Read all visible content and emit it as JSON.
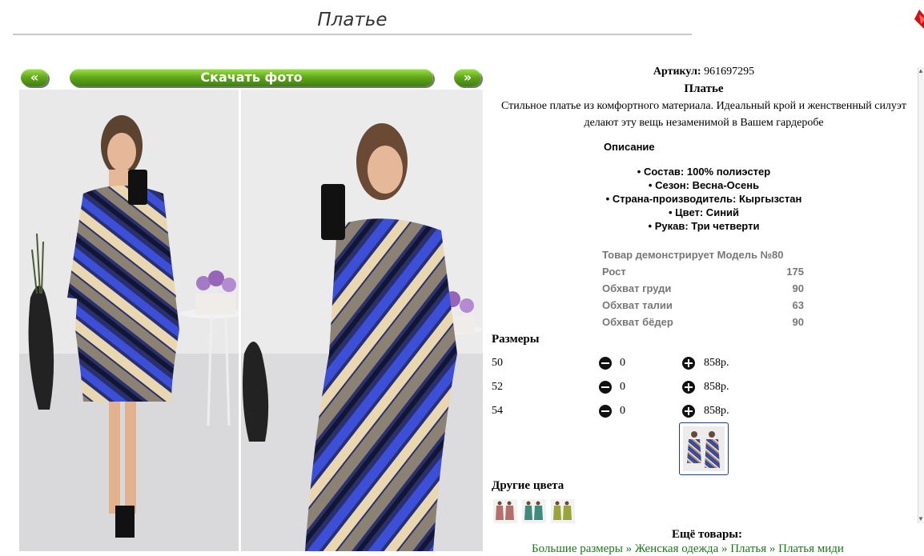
{
  "header": {
    "title": "Платье"
  },
  "gallery": {
    "prev_label": "«",
    "download_label": "Скачать фото",
    "next_label": "»"
  },
  "product": {
    "artikul_label": "Артикул:",
    "artikul_value": "961697295",
    "name": "Платье",
    "description": "Стильное платье из комфортного материала. Идеальный крой и женственный силуэт делают эту вещь незаменимой в Вашем гардеробе",
    "description_heading": "Описание",
    "features": [
      "Состав: 100% полиэстер",
      "Сезон: Весна-Осень",
      "Страна-производитель: Кыргызстан",
      "Цвет: Синий",
      "Рукав: Три четверти"
    ],
    "model": {
      "heading": "Товар демонстрирует Модель №80",
      "rows": [
        {
          "label": "Рост",
          "value": "175"
        },
        {
          "label": "Обхват груди",
          "value": "90"
        },
        {
          "label": "Обхват талии",
          "value": "63"
        },
        {
          "label": "Обхват бёдер",
          "value": "90"
        }
      ]
    },
    "sizes_heading": "Размеры",
    "sizes": [
      {
        "size": "50",
        "qty": "0",
        "price": "858р."
      },
      {
        "size": "52",
        "qty": "0",
        "price": "858р."
      },
      {
        "size": "54",
        "qty": "0",
        "price": "858р."
      }
    ],
    "other_colors_heading": "Другие цвета",
    "more_heading": "Ещё товары:",
    "breadcrumbs_text": "Большие размеры » Женская одежда » Платья » Платья миди"
  },
  "colors": {
    "accent_green": "#5fa61a",
    "link_green": "#1a7a1a",
    "muted_text": "#777777"
  }
}
